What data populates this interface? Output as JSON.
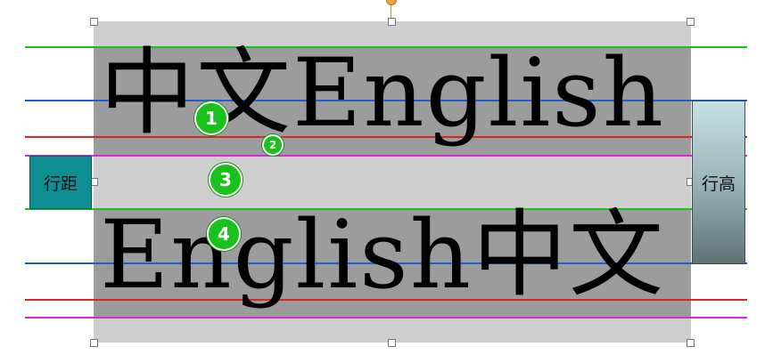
{
  "sample_lines": {
    "line1": "中文English",
    "line2": "English中文"
  },
  "labels": {
    "line_spacing": "行距",
    "line_height": "行高"
  },
  "markers": [
    "1",
    "2",
    "3",
    "4"
  ],
  "colors": {
    "background_box": "#cfcfcf",
    "text_band": "#9c9c9c",
    "top_guide": "#1fbf1f",
    "baseline_guide": "#1f5fd0",
    "bottom_guide": "#e02424",
    "line_bottom_guide": "#d02ed0",
    "marker": "#19c11c",
    "line_spacing_label": "#0f8f93"
  }
}
